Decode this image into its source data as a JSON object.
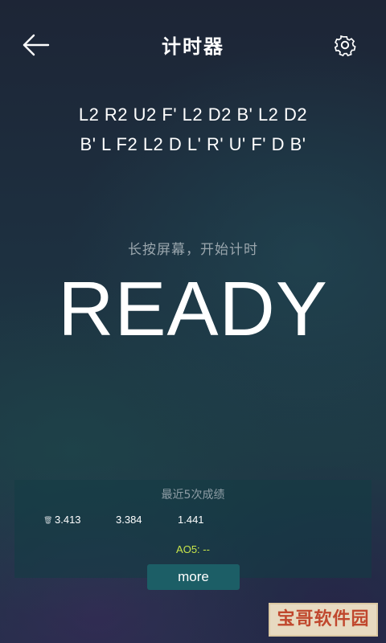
{
  "header": {
    "title": "计时器",
    "back_icon": "arrow-left-icon",
    "settings_icon": "gear-icon"
  },
  "scramble": {
    "line1": "L2 R2 U2 F' L2 D2 B' L2 D2",
    "line2": "B' L F2 L2 D L' R' U' F' D B'"
  },
  "timer": {
    "hint": "长按屏幕，开始计时",
    "status": "READY"
  },
  "recent": {
    "title": "最近5次成绩",
    "delete_icon": "trash-icon",
    "results": [
      "3.413",
      "3.384",
      "1.441"
    ],
    "ao5": "AO5: --",
    "more_label": "more"
  },
  "watermark": {
    "text": "宝哥软件园"
  },
  "colors": {
    "accent_yellow": "#c9e64a",
    "button_bg": "#1c5e66",
    "hint_gray": "#9aa6ad",
    "watermark_red": "#c9492c"
  }
}
